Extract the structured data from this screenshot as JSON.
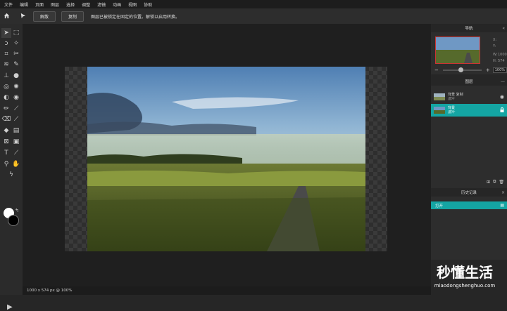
{
  "menu": [
    "文件",
    "编辑",
    "页面",
    "图层",
    "选择",
    "调整",
    "滤镜",
    "动画",
    "视图",
    "协助"
  ],
  "options": {
    "btn1": "解散",
    "btn2": "复制",
    "message": "图层已被锁定在固定的位置。解锁以启用转换。"
  },
  "status": {
    "info": "1000 x 574 px @ 100%"
  },
  "navigator": {
    "title": "导航",
    "x_label": "X:",
    "y_label": "Y:",
    "w_label": "W:",
    "w_value": "1000",
    "h_label": "H:",
    "h_value": "574",
    "zoom": "100%",
    "zoom_fraction": 0.45
  },
  "layers": {
    "title": "图层",
    "items": [
      {
        "name": "背景 复制",
        "sub": "图片",
        "selected": false,
        "icon": "eye-icon"
      },
      {
        "name": "背景",
        "sub": "图片",
        "selected": true,
        "icon": "lock-icon"
      }
    ]
  },
  "history": {
    "title": "历史记录",
    "items": [
      "打开"
    ]
  },
  "watermark": {
    "title": "秒懂生活",
    "url": "miaodongshenghuo.com"
  },
  "colors": {
    "accent": "#14a5a3",
    "foreground": "#ffffff",
    "background": "#000000"
  }
}
